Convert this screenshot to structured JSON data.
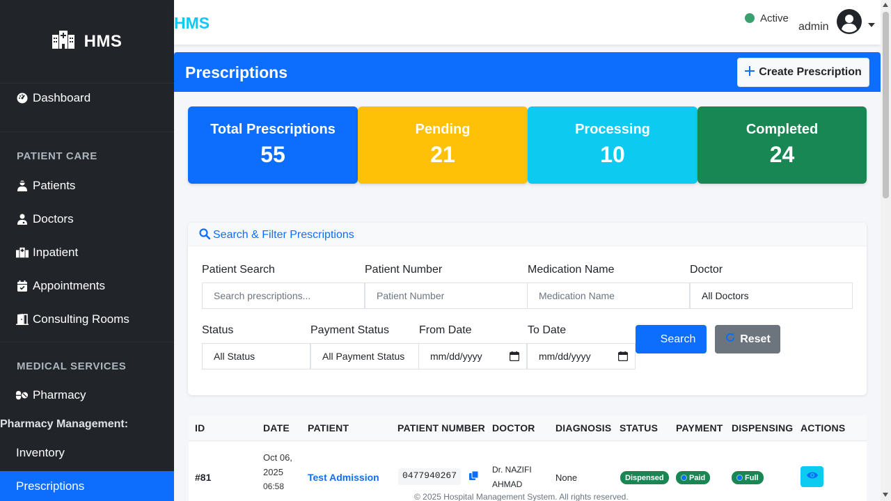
{
  "sidebar": {
    "brand": "HMS",
    "items": {
      "dashboard": "Dashboard",
      "patients": "Patients",
      "doctors": "Doctors",
      "inpatient": "Inpatient",
      "appointments": "Appointments",
      "consulting_rooms": "Consulting Rooms",
      "pharmacy": "Pharmacy",
      "inventory": "Inventory",
      "prescriptions": "Prescriptions"
    },
    "headings": {
      "patient_care": "PATIENT CARE",
      "medical_services": "MEDICAL SERVICES"
    },
    "submenu_title": "Pharmacy Management:"
  },
  "topbar": {
    "title": "HMS",
    "status": "Active",
    "user": "admin"
  },
  "page": {
    "title": "Prescriptions",
    "create_button": "Create Prescription"
  },
  "stats": {
    "total": {
      "label": "Total Prescriptions",
      "value": "55",
      "color": "#0d6efd"
    },
    "pending": {
      "label": "Pending",
      "value": "21",
      "color": "#ffc107"
    },
    "processing": {
      "label": "Processing",
      "value": "10",
      "color": "#0dcaf0"
    },
    "completed": {
      "label": "Completed",
      "value": "24",
      "color": "#198754"
    }
  },
  "filters": {
    "title": "Search & Filter Prescriptions",
    "patient_search": {
      "label": "Patient Search",
      "placeholder": "Search prescriptions..."
    },
    "patient_number": {
      "label": "Patient Number",
      "placeholder": "Patient Number"
    },
    "medication_name": {
      "label": "Medication Name",
      "placeholder": "Medication Name"
    },
    "doctor": {
      "label": "Doctor",
      "value": "All Doctors"
    },
    "status": {
      "label": "Status",
      "value": "All Status"
    },
    "payment_status": {
      "label": "Payment Status",
      "value": "All Payment Status"
    },
    "from_date": {
      "label": "From Date",
      "value": "mm/dd/yyyy"
    },
    "to_date": {
      "label": "To Date",
      "value": "mm/dd/yyyy"
    },
    "search_button": "Search",
    "reset_button": "Reset"
  },
  "table": {
    "headers": {
      "id": "ID",
      "date": "DATE",
      "patient": "PATIENT",
      "patient_number": "PATIENT NUMBER",
      "doctor": "DOCTOR",
      "diagnosis": "DIAGNOSIS",
      "status": "STATUS",
      "payment": "PAYMENT",
      "dispensing": "DISPENSING",
      "actions": "ACTIONS"
    },
    "rows": [
      {
        "id": "#81",
        "date_line1": "Oct 06,",
        "date_line2": "2025",
        "time": "06:58",
        "patient": "Test Admission",
        "patient_number": "0477940267",
        "doctor_line1": "Dr. NAZIFI",
        "doctor_line2": "AHMAD",
        "diagnosis": "None",
        "status": "Dispensed",
        "payment": "Paid",
        "dispensing": "Full"
      }
    ]
  },
  "footer": "© 2025 Hospital Management System. All rights reserved."
}
